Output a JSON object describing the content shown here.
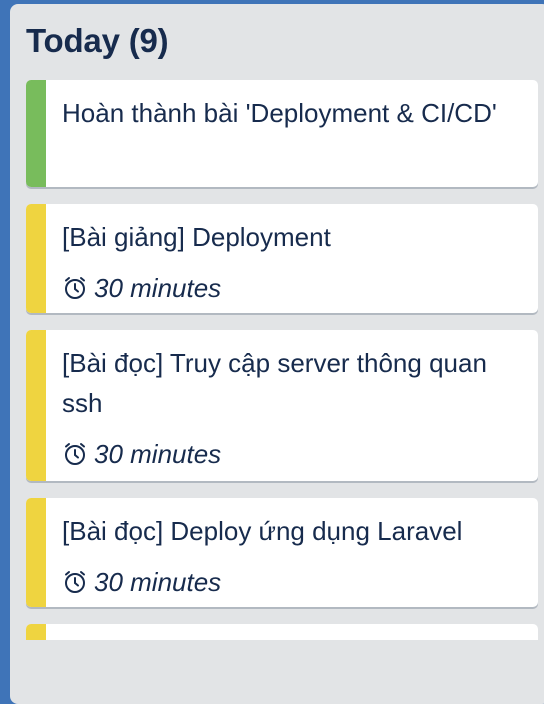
{
  "column": {
    "title": "Today (9)",
    "colors": {
      "background": "#e2e4e6",
      "board": "#3f74b8",
      "green_label": "#78bc5c",
      "yellow_label": "#efd440"
    }
  },
  "cards": [
    {
      "title": "Hoàn thành bài 'Deployment & CI/CD'",
      "label_color": "green",
      "duration": "",
      "icon": ""
    },
    {
      "title": "[Bài giảng] Deployment",
      "label_color": "yellow",
      "duration": "30 minutes",
      "icon": "alarm-clock-icon"
    },
    {
      "title": "[Bài đọc] Truy cập server thông quan ssh",
      "label_color": "yellow",
      "duration": "30 minutes",
      "icon": "alarm-clock-icon"
    },
    {
      "title": "[Bài đọc] Deploy ứng dụng Laravel",
      "label_color": "yellow",
      "duration": "30 minutes",
      "icon": "alarm-clock-icon"
    },
    {
      "title": "",
      "label_color": "yellow",
      "duration": "",
      "icon": ""
    }
  ]
}
